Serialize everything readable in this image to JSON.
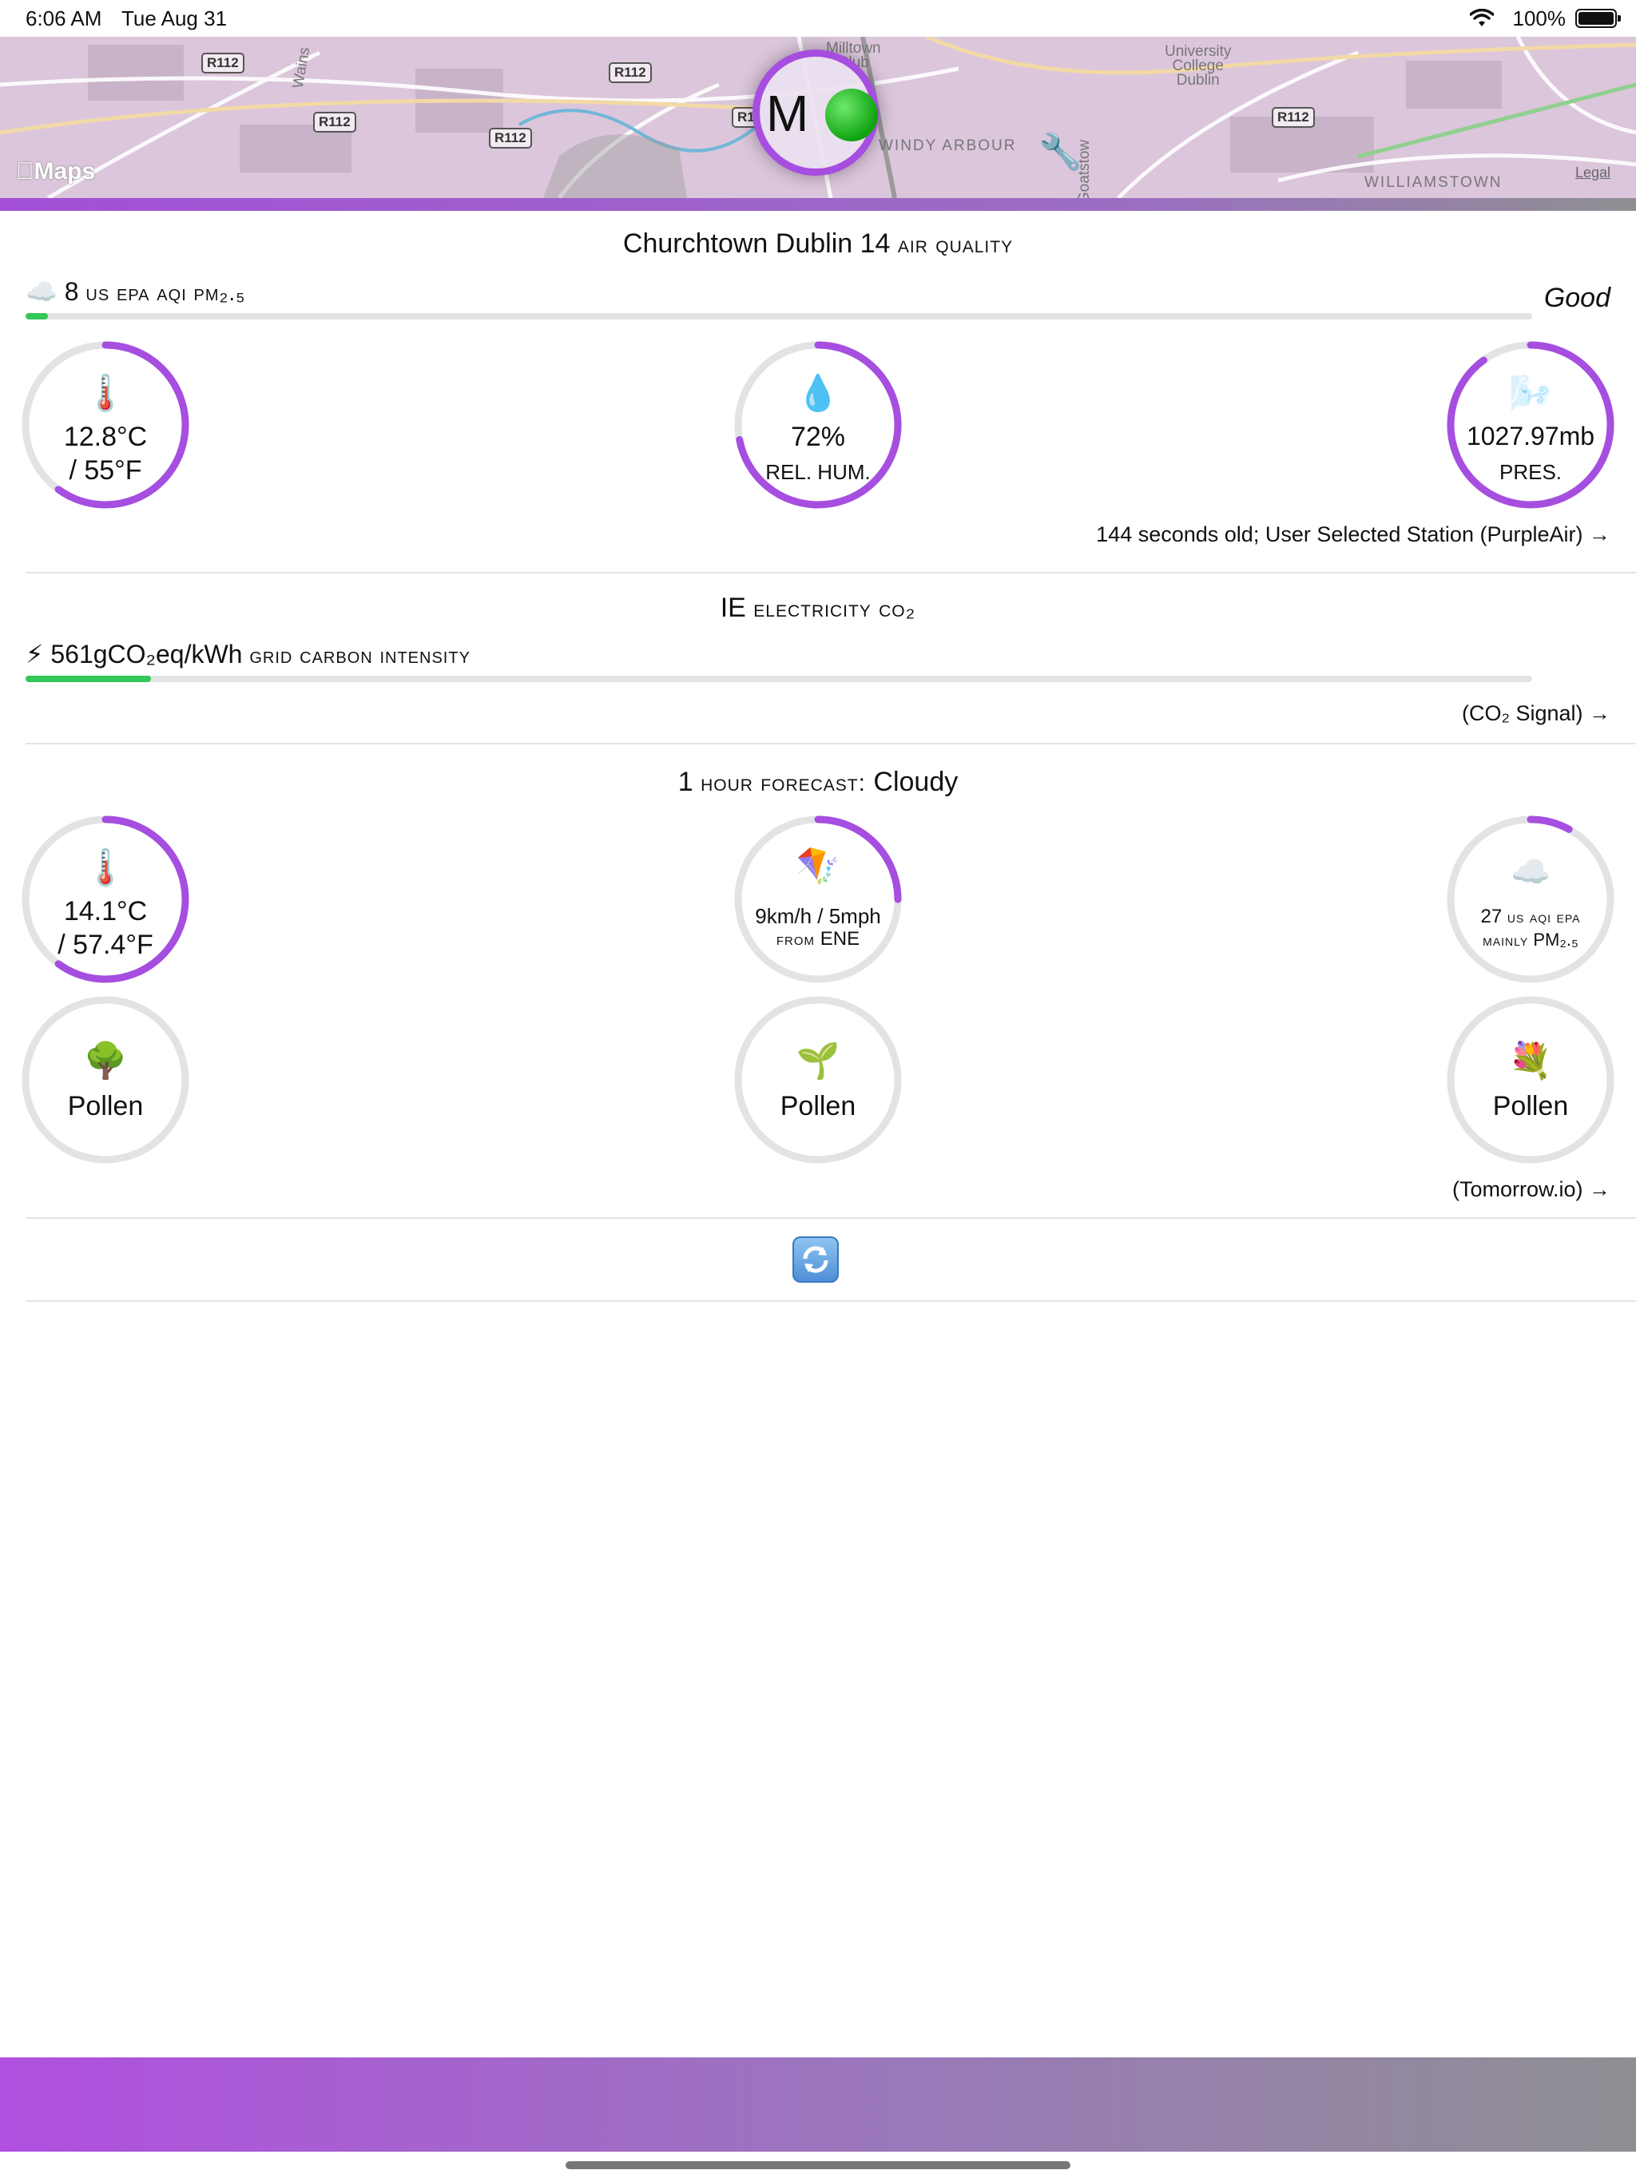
{
  "status_bar": {
    "time": "6:06 AM",
    "date": "Tue Aug 31",
    "battery_pct": "100%",
    "icons": [
      "wifi-icon",
      "battery-icon"
    ]
  },
  "map": {
    "road_labels": [
      "R112",
      "R112",
      "R112",
      "R112",
      "R1",
      "R112",
      "R112"
    ],
    "places": {
      "milltown": "Milltown\nClub",
      "ucd": "University\nCollege\nDublin",
      "windy_arbour": "WINDY ARBOUR",
      "williamstown": "WILLIAMSTOWN",
      "wains": "Wains",
      "goatstown": "Goatstow"
    },
    "maps_logo": "Maps",
    "legal": "Legal",
    "marker_letter": "M",
    "marker_status": "green",
    "icons": [
      "wrench-icon"
    ]
  },
  "air_quality": {
    "title_main": "Churchtown Dublin 14",
    "title_sc": "air quality",
    "aqi_icon": "cloud-icon",
    "aqi_value": "8",
    "aqi_label": "us epa aqi pm₂.₅",
    "aqi_status": "Good",
    "aqi_fraction": 0.015,
    "temperature": {
      "icon": "thermometer-icon",
      "c": "12.8°C",
      "f": "/ 55°F",
      "level": 0.6
    },
    "humidity": {
      "icon": "droplet-icon",
      "value": "72%",
      "label": "REL. HUM.",
      "level": 0.72
    },
    "pressure": {
      "icon": "wind-face-icon",
      "value": "1027.97mb",
      "label": "PRES.",
      "level": 0.9
    },
    "source_note": "144 seconds old; User Selected Station (PurpleAir) →"
  },
  "electricity": {
    "title_main": "IE",
    "title_sc": "electricity co₂",
    "icon": "lightning-icon",
    "value": "561gCO₂eq/kWh",
    "label": "grid carbon intensity",
    "fraction": 0.083,
    "source_note": "(CO₂ Signal) →"
  },
  "forecast": {
    "title_prefix": "1",
    "title_sc": "hour forecast:",
    "title_condition": "Cloudy",
    "temperature": {
      "icon": "thermometer-icon",
      "c": "14.1°C",
      "f": "/ 57.4°F",
      "level": 0.6
    },
    "wind": {
      "icon": "kite-icon",
      "value": "9km/h / 5mph",
      "from_sc": "from",
      "direction": "ENE",
      "level": 0.25
    },
    "aqi": {
      "icon": "cloud-icon",
      "value": "27",
      "label_sc": "us aqi epa",
      "mainly_sc": "mainly",
      "pollutant": "PM₂.₅",
      "level": 0.08
    },
    "pollen": [
      {
        "icon": "tree-icon",
        "label": "Pollen"
      },
      {
        "icon": "seedling-icon",
        "label": "Pollen"
      },
      {
        "icon": "bouquet-icon",
        "label": "Pollen"
      }
    ],
    "source_note": "(Tomorrow.io) →"
  },
  "refresh": {
    "icon": "refresh-icon"
  },
  "colors": {
    "accent": "#a64ee0",
    "track": "#e3e3e6",
    "good": "#34c759"
  }
}
